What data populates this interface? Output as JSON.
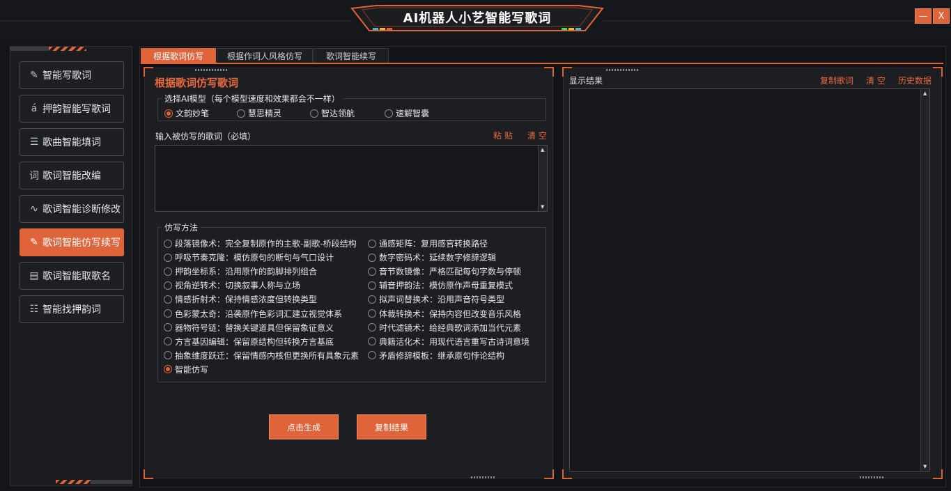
{
  "app": {
    "title": "AI机器人小艺智能写歌词",
    "minimize_label": "—",
    "close_label": "X"
  },
  "sidebar": {
    "items": [
      {
        "label": "智能写歌词",
        "icon": "pen-icon",
        "glyph": "✎"
      },
      {
        "label": "押韵智能写歌词",
        "icon": "accent-a-icon",
        "glyph": "á"
      },
      {
        "label": "歌曲智能填词",
        "icon": "list-icon",
        "glyph": "☰"
      },
      {
        "label": "歌词智能改编",
        "icon": "word-box-icon",
        "glyph": "词"
      },
      {
        "label": "歌词智能诊断修改",
        "icon": "pulse-icon",
        "glyph": "∿"
      },
      {
        "label": "歌词智能仿写续写",
        "icon": "edit-icon",
        "glyph": "✎"
      },
      {
        "label": "歌词智能取歌名",
        "icon": "document-icon",
        "glyph": "▤"
      },
      {
        "label": "智能找押韵词",
        "icon": "sliders-icon",
        "glyph": "☷"
      }
    ],
    "active_index": 5
  },
  "tabs": [
    "根据歌词仿写",
    "根据作词人风格仿写",
    "歌词智能续写"
  ],
  "left_panel": {
    "title": "根据歌词仿写歌词",
    "model_group_label": "选择AI模型（每个模型速度和效果都会不一样）",
    "models": [
      "文韵妙笔",
      "慧思精灵",
      "智达领航",
      "速解智囊"
    ],
    "selected_model": 0,
    "input_label": "输入被仿写的歌词（必填）",
    "paste_label": "粘 贴",
    "clear_label": "清 空",
    "input_value": "",
    "method_group_label": "仿写方法",
    "methods_left": [
      "段落镜像术：完全复制原作的主歌-副歌-桥段结构",
      "呼吸节奏克隆：模仿原句的断句与气口设计",
      "押韵坐标系：沿用原作的韵脚排列组合",
      "视角逆转术：切换叙事人称与立场",
      "情感折射术：保持情感浓度但转换类型",
      "色彩蒙太奇：沿袭原作色彩词汇建立视觉体系",
      "器物符号链：替换关键道具但保留象征意义",
      "方言基因编辑：保留原结构但转换方言基底",
      "抽象维度跃迁：保留情感内核但更换所有具象元素",
      "智能仿写"
    ],
    "methods_right": [
      "通感矩阵：复用感官转换路径",
      "数字密码术：延续数字修辞逻辑",
      "音节数镜像：严格匹配每句字数与停顿",
      "辅音押韵法：模仿原作声母重复模式",
      "拟声词替换术：沿用声音符号类型",
      "体裁转换术：保持内容但改变音乐风格",
      "时代滤镜术：给经典歌词添加当代元素",
      "典籍活化术：用现代语言重写古诗词意境",
      "矛盾修辞模板：继承原句悖论结构"
    ],
    "selected_method": "智能仿写",
    "generate_label": "点击生成",
    "copy_result_label": "复制结果"
  },
  "right_panel": {
    "title": "显示结果",
    "copy_label": "复制歌词",
    "clear_label": "清 空",
    "history_label": "历史数据",
    "output_value": ""
  }
}
